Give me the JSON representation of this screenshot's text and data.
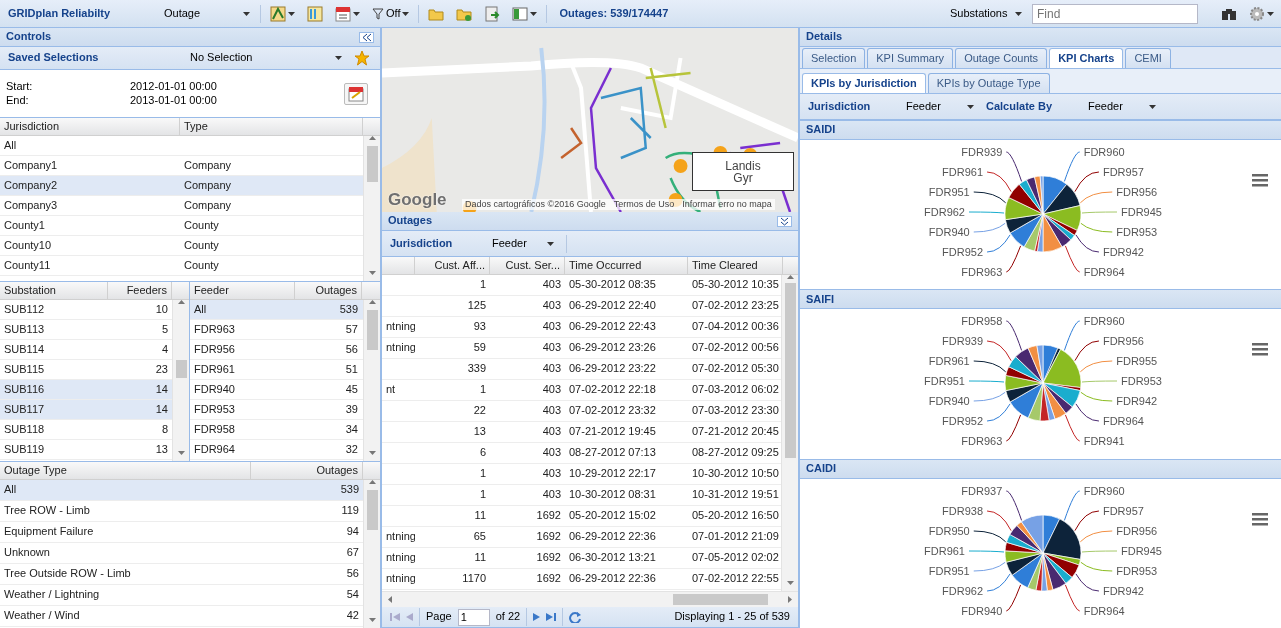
{
  "toolbar": {
    "app_title": "GRIDplan Reliabilty",
    "view_select": "Outage",
    "filter": "Off",
    "outages_count": "Outages: 539/174447",
    "search_scope": "Substations",
    "search": {
      "placeholder": "Find"
    }
  },
  "controls": {
    "title": "Controls",
    "saved_selections": {
      "label": "Saved Selections",
      "value": "No Selection"
    },
    "start_label": "Start:",
    "start": "2012-01-01 00:00",
    "end_label": "End:",
    "end": "2013-01-01 00:00",
    "jurisdiction_grid": {
      "columns": [
        "Jurisdiction",
        "Type"
      ],
      "rows": [
        {
          "name": "All",
          "selected": false
        },
        {
          "name": "Company1",
          "type": "Company",
          "selected": false
        },
        {
          "name": "Company2",
          "type": "Company",
          "selected": true
        },
        {
          "name": "Company3",
          "type": "Company",
          "selected": false
        },
        {
          "name": "County1",
          "type": "County",
          "selected": false
        },
        {
          "name": "County10",
          "type": "County",
          "selected": false
        },
        {
          "name": "County11",
          "type": "County",
          "selected": false
        }
      ]
    },
    "substation_grid": {
      "columns": [
        "Substation",
        "Feeders"
      ],
      "rows": [
        {
          "name": "SUB112",
          "count": "10",
          "selected": false
        },
        {
          "name": "SUB113",
          "count": "5",
          "selected": false
        },
        {
          "name": "SUB114",
          "count": "4",
          "selected": false
        },
        {
          "name": "SUB115",
          "count": "23",
          "selected": false
        },
        {
          "name": "SUB116",
          "count": "14",
          "selected": true
        },
        {
          "name": "SUB117",
          "count": "14",
          "selected": true
        },
        {
          "name": "SUB118",
          "count": "8",
          "selected": false
        },
        {
          "name": "SUB119",
          "count": "13",
          "selected": false
        }
      ]
    },
    "feeder_grid": {
      "columns": [
        "Feeder",
        "Outages"
      ],
      "rows": [
        {
          "name": "All",
          "count": "539",
          "selected": true
        },
        {
          "name": "FDR963",
          "count": "57",
          "selected": false
        },
        {
          "name": "FDR956",
          "count": "56",
          "selected": false
        },
        {
          "name": "FDR961",
          "count": "51",
          "selected": false
        },
        {
          "name": "FDR940",
          "count": "45",
          "selected": false
        },
        {
          "name": "FDR953",
          "count": "39",
          "selected": false
        },
        {
          "name": "FDR958",
          "count": "34",
          "selected": false
        },
        {
          "name": "FDR964",
          "count": "32",
          "selected": false
        }
      ]
    },
    "outage_type_grid": {
      "columns": [
        "Outage Type",
        "Outages"
      ],
      "rows": [
        {
          "name": "All",
          "count": "539",
          "selected": true
        },
        {
          "name": "Tree ROW - Limb",
          "count": "119",
          "selected": false
        },
        {
          "name": "Equipment Failure",
          "count": "94",
          "selected": false
        },
        {
          "name": "Unknown",
          "count": "67",
          "selected": false
        },
        {
          "name": "Tree Outside ROW - Limb",
          "count": "56",
          "selected": false
        },
        {
          "name": "Weather / Lightning",
          "count": "54",
          "selected": false
        },
        {
          "name": "Weather / Wind",
          "count": "42",
          "selected": false
        }
      ]
    }
  },
  "map": {
    "google_logo": "Google",
    "attribution": "Dados cartográficos ©2016 Google",
    "terms": "Termos de Uso",
    "report": "Informar erro no mapa",
    "logo_lines": [
      "Landis",
      "Gyr"
    ]
  },
  "outages": {
    "title": "Outages",
    "toolbar": {
      "label": "Jurisdiction",
      "value": "Feeder"
    },
    "columns": [
      "Cust. Aff...",
      "Cust. Ser...",
      "Time Occurred",
      "Time Cleared"
    ],
    "rows": [
      {
        "cust_aff": "1",
        "cust_ser": "403",
        "occurred": "05-30-2012 08:35",
        "cleared": "05-30-2012 10:35"
      },
      {
        "cust_aff": "125",
        "cust_ser": "403",
        "occurred": "06-29-2012 22:40",
        "cleared": "07-02-2012 23:25"
      },
      {
        "column_1": "ntning",
        "cust_aff": "93",
        "cust_ser": "403",
        "occurred": "06-29-2012 22:43",
        "cleared": "07-04-2012 00:36"
      },
      {
        "column_1": "ntning",
        "cust_aff": "59",
        "cust_ser": "403",
        "occurred": "06-29-2012 23:26",
        "cleared": "07-02-2012 00:56"
      },
      {
        "cust_aff": "339",
        "cust_ser": "403",
        "occurred": "06-29-2012 23:22",
        "cleared": "07-02-2012 05:30"
      },
      {
        "column_1": "nt",
        "cust_aff": "1",
        "cust_ser": "403",
        "occurred": "07-02-2012 22:18",
        "cleared": "07-03-2012 06:02"
      },
      {
        "cust_aff": "22",
        "cust_ser": "403",
        "occurred": "07-02-2012 23:32",
        "cleared": "07-03-2012 23:30"
      },
      {
        "cust_aff": "13",
        "cust_ser": "403",
        "occurred": "07-21-2012 19:45",
        "cleared": "07-21-2012 20:45"
      },
      {
        "cust_aff": "6",
        "cust_ser": "403",
        "occurred": "08-27-2012 07:13",
        "cleared": "08-27-2012 09:25"
      },
      {
        "cust_aff": "1",
        "cust_ser": "403",
        "occurred": "10-29-2012 22:17",
        "cleared": "10-30-2012 10:50"
      },
      {
        "cust_aff": "1",
        "cust_ser": "403",
        "occurred": "10-30-2012 08:31",
        "cleared": "10-31-2012 19:51"
      },
      {
        "cust_aff": "11",
        "cust_ser": "1692",
        "occurred": "05-20-2012 15:02",
        "cleared": "05-20-2012 16:50"
      },
      {
        "column_1": "ntning",
        "cust_aff": "65",
        "cust_ser": "1692",
        "occurred": "06-29-2012 22:36",
        "cleared": "07-01-2012 21:09"
      },
      {
        "column_1": "ntning",
        "cust_aff": "11",
        "cust_ser": "1692",
        "occurred": "06-30-2012 13:21",
        "cleared": "07-05-2012 02:02"
      },
      {
        "column_1": "ntning",
        "cust_aff": "1170",
        "cust_ser": "1692",
        "occurred": "06-29-2012 22:36",
        "cleared": "07-02-2012 22:55"
      }
    ],
    "pager": {
      "page_label": "Page",
      "page": "1",
      "of": "of 22",
      "display": "Displaying 1 - 25 of 539"
    }
  },
  "details": {
    "title": "Details",
    "tabs": [
      {
        "label": "Selection",
        "selected": false
      },
      {
        "label": "KPI Summary",
        "selected": false
      },
      {
        "label": "Outage Counts",
        "selected": false
      },
      {
        "label": "KPI Charts",
        "selected": true
      },
      {
        "label": "CEMI",
        "selected": false
      }
    ],
    "subtabs": [
      {
        "label": "KPIs by Jurisdiction",
        "selected": true
      },
      {
        "label": "KPIs by Outage Type",
        "selected": false
      }
    ],
    "toolbar": {
      "jurisdiction_label": "Jurisdiction",
      "jurisdiction": "Feeder",
      "calc_label": "Calculate By",
      "calc": "Feeder"
    },
    "charts": [
      {
        "title": "SAIDI",
        "right_labels": [
          "FDR960",
          "FDR957",
          "FDR956",
          "FDR945",
          "FDR953",
          "FDR942",
          "FDR964"
        ],
        "left_labels": [
          "FDR939",
          "FDR961",
          "FDR951",
          "FDR962",
          "FDR940",
          "FDR952",
          "FDR963"
        ]
      },
      {
        "title": "SAIFI",
        "right_labels": [
          "FDR960",
          "FDR956",
          "FDR955",
          "FDR953",
          "FDR942",
          "FDR964",
          "FDR941"
        ],
        "left_labels": [
          "FDR958",
          "FDR939",
          "FDR961",
          "FDR951",
          "FDR940",
          "FDR952",
          "FDR963"
        ]
      },
      {
        "title": "CAIDI",
        "right_labels": [
          "FDR960",
          "FDR957",
          "FDR956",
          "FDR945",
          "FDR953",
          "FDR942",
          "FDR964"
        ],
        "left_labels": [
          "FDR937",
          "FDR938",
          "FDR950",
          "FDR961",
          "FDR951",
          "FDR962",
          "FDR940"
        ]
      }
    ]
  }
}
